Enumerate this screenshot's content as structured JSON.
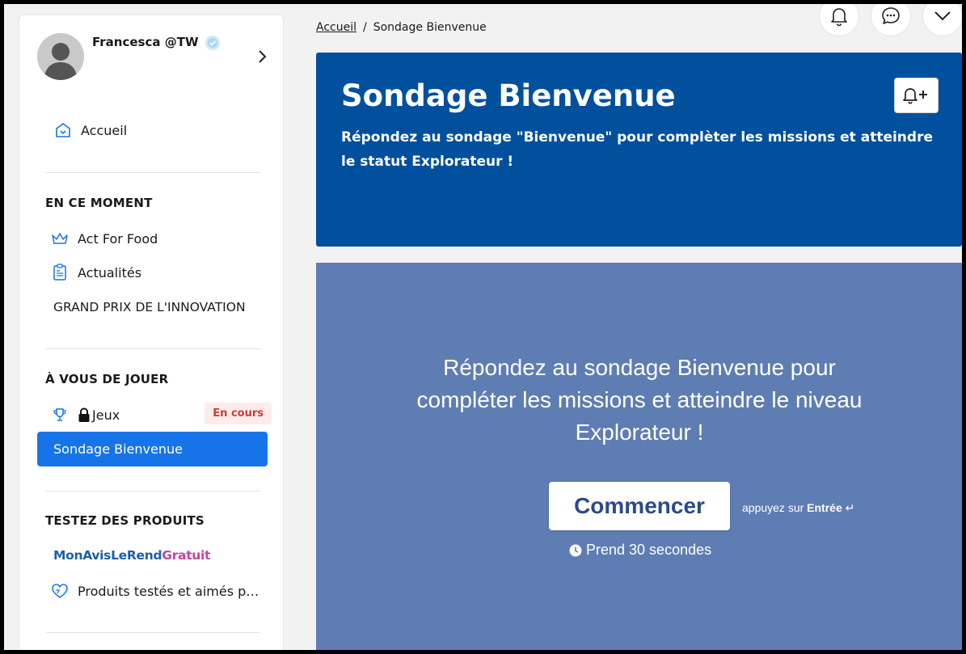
{
  "profile": {
    "name": "Francesca @TW"
  },
  "sidebar": {
    "home": {
      "label": "Accueil",
      "icon": "home-icon"
    },
    "section_now": {
      "title": "EN CE MOMENT",
      "items": [
        {
          "label": "Act For Food",
          "icon": "crown-icon"
        },
        {
          "label": "Actualités",
          "icon": "news-icon"
        },
        {
          "label": "GRAND PRIX DE L'INNOVATION"
        }
      ]
    },
    "section_play": {
      "title": "À VOUS DE JOUER",
      "games": {
        "label": "Jeux",
        "icon": "trophy-icon",
        "badge": "En cours"
      },
      "active": {
        "label": "Sondage Bienvenue"
      }
    },
    "section_test": {
      "title": "TESTEZ DES PRODUITS",
      "brand": {
        "part1": "MonAvisLeRend",
        "part2": "Gratuit"
      },
      "tested": {
        "label": "Produits testés et aimés p…",
        "icon": "heart-icon"
      }
    }
  },
  "breadcrumb": {
    "home": "Accueil",
    "separator": "/",
    "current": "Sondage Bienvenue"
  },
  "banner": {
    "title": "Sondage Bienvenue",
    "description": "Répondez au sondage \"Bienvenue\" pour complèter les missions et atteindre le statut Explorateur !"
  },
  "survey": {
    "text": "Répondez au sondage Bienvenue pour compléter les missions et atteindre le niveau Explorateur !",
    "start_label": "Commencer",
    "hint_prefix": "appuyez sur",
    "hint_key": "Entrée",
    "hint_symbol": "↵",
    "duration": "Prend 30 secondes"
  },
  "colors": {
    "banner": "#00509e",
    "survey_bg": "#5e7db3",
    "active_nav": "#1774e8",
    "badge_bg": "#fdecea",
    "badge_text": "#d03b30",
    "brand_blue": "#1d5fa8",
    "brand_pink": "#c7469a"
  }
}
